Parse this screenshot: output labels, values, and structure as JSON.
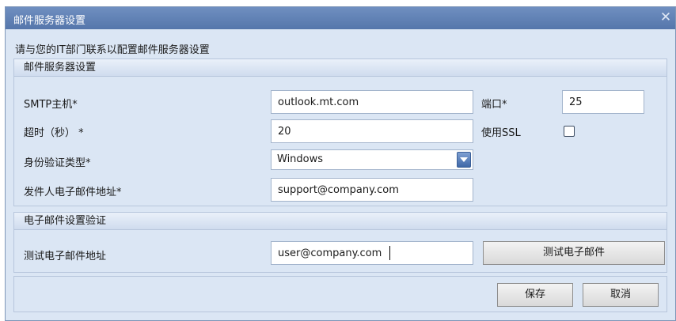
{
  "window": {
    "title": "邮件服务器设置",
    "close_glyph": "✕"
  },
  "instruction": "请与您的IT部门联系以配置邮件服务器设置",
  "server_group": {
    "header": "邮件服务器设置",
    "smtp_host": {
      "label": "SMTP主机*",
      "value": "outlook.mt.com"
    },
    "port": {
      "label": "端口*",
      "value": "25"
    },
    "timeout": {
      "label": "超时（秒） *",
      "value": "20"
    },
    "use_ssl": {
      "label": "使用SSL",
      "checked": false
    },
    "auth_type": {
      "label": "身份验证类型*",
      "value": "Windows"
    },
    "sender": {
      "label": "发件人电子邮件地址*",
      "value": "support@company.com"
    }
  },
  "verify_group": {
    "header": "电子邮件设置验证",
    "test_address": {
      "label": "测试电子邮件地址",
      "value": "user@company.com"
    },
    "test_button": "测试电子邮件"
  },
  "footer": {
    "save": "保存",
    "cancel": "取消"
  },
  "colors": {
    "title_bar": "#5576ab",
    "dialog_bg": "#dbe6f4",
    "group_border": "#b7c6dc",
    "dropdown_button": "#3f68a8"
  },
  "icons": {
    "close": "close-icon",
    "dropdown": "chevron-down-icon",
    "checkbox": "checkbox-unchecked"
  }
}
